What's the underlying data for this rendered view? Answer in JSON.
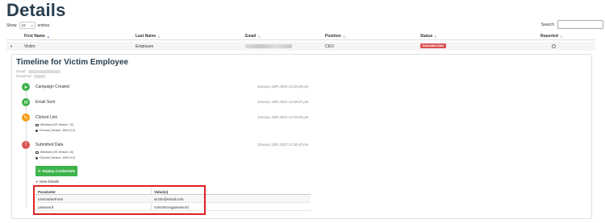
{
  "page": {
    "title": "Details"
  },
  "table_controls": {
    "show_label": "Show",
    "show_value": "10",
    "entries_label": "entries",
    "search_label": "Search:"
  },
  "table": {
    "columns": [
      "First Name",
      "Last Name",
      "Email",
      "Position",
      "Status",
      "Reported"
    ],
    "row": {
      "first_name": "Victim",
      "last_name": "Employee",
      "position": "CEO",
      "status": "Submitted Data"
    }
  },
  "timeline": {
    "title": "Timeline for Victim Employee",
    "email_label": "Email:",
    "result_id_label": "Result ID:",
    "events": [
      {
        "label": "Campaign Created",
        "time": "January 10th 2023 12:26:05 pm",
        "icon": "rocket-icon",
        "color": "#3eb34a"
      },
      {
        "label": "Email Sent",
        "time": "January 10th 2023 12:28:07 pm",
        "icon": "envelope-icon",
        "color": "#3eb34a"
      },
      {
        "label": "Clicked Link",
        "time": "January 10th 2023 12:33:05 pm",
        "icon": "pointer-icon",
        "color": "#f59c1a",
        "meta": [
          "Windows (OS Version: 10)",
          "Chrome (Version: 108.0.0.0)"
        ]
      },
      {
        "label": "Submitted Data",
        "time": "January 10th 2023 12:38:45 pm",
        "icon": "exclamation-icon",
        "color": "#d9534f",
        "meta": [
          "Windows (OS Version: 10)",
          "Chrome (Version: 108.0.0.0)"
        ]
      }
    ],
    "replay_button": "Replay Credentials",
    "view_details": "View Details"
  },
  "params": {
    "headers": [
      "Parameter",
      "Value(s)"
    ],
    "rows": [
      {
        "param": "UsernameForm",
        "value": "victim@email.com"
      },
      {
        "param": "password",
        "value": "notsostrongpassword"
      }
    ]
  },
  "colors": {
    "heading": "#283f50",
    "success": "#3eb34a",
    "warning": "#f59c1a",
    "danger": "#d9534f",
    "highlight": "#e02020"
  }
}
